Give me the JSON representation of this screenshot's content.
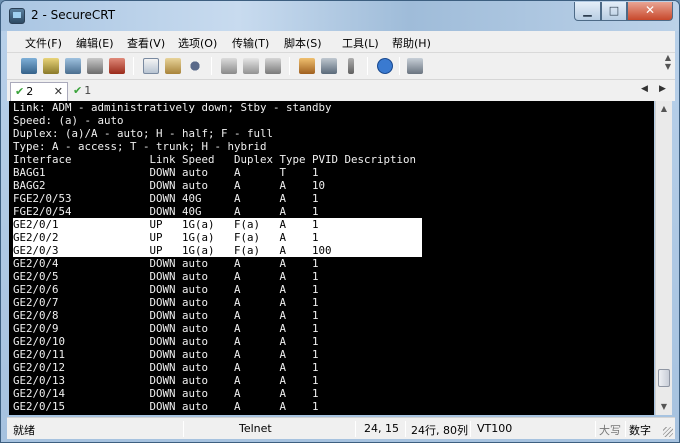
{
  "window": {
    "title": "2 - SecureCRT"
  },
  "menu": [
    "文件(F)",
    "编辑(E)",
    "查看(V)",
    "选项(O)",
    "传输(T)",
    "脚本(S)",
    "工具(L)",
    "帮助(H)"
  ],
  "toolbar": {
    "icons": [
      "connect-icon",
      "quick-connect-icon",
      "connect-in-tab-icon",
      "reconnect-icon",
      "disconnect-icon",
      "copy-icon",
      "paste-icon",
      "find-icon",
      "print-setup-icon",
      "print-icon",
      "print-screen-icon",
      "session-options-icon",
      "global-options-icon",
      "keymap-icon",
      "help-icon",
      "connect-sftp-icon"
    ]
  },
  "tabs": [
    {
      "label": "2",
      "active": true,
      "close": "✕"
    },
    {
      "label": "1",
      "active": false
    }
  ],
  "terminal": {
    "lines": [
      {
        "text": "Link: ADM - administratively down; Stby - standby"
      },
      {
        "text": "Speed: (a) - auto"
      },
      {
        "text": "Duplex: (a)/A - auto; H - half; F - full"
      },
      {
        "text": "Type: A - access; T - trunk; H - hybrid"
      },
      {
        "text": "Interface            Link Speed   Duplex Type PVID Description"
      },
      {
        "text": "BAGG1                DOWN auto    A      T    1"
      },
      {
        "text": "BAGG2                DOWN auto    A      A    10"
      },
      {
        "text": "FGE2/0/53            DOWN 40G     A      A    1"
      },
      {
        "text": "FGE2/0/54            DOWN 40G     A      A    1"
      },
      {
        "text": "GE2/0/1              UP   1G(a)   F(a)   A    1",
        "selected": true
      },
      {
        "text": "GE2/0/2              UP   1G(a)   F(a)   A    1",
        "selected": true
      },
      {
        "text": "GE2/0/3              UP   1G(a)   F(a)   A    100",
        "selected": true
      },
      {
        "text": "GE2/0/4              DOWN auto    A      A    1"
      },
      {
        "text": "GE2/0/5              DOWN auto    A      A    1"
      },
      {
        "text": "GE2/0/6              DOWN auto    A      A    1"
      },
      {
        "text": "GE2/0/7              DOWN auto    A      A    1"
      },
      {
        "text": "GE2/0/8              DOWN auto    A      A    1"
      },
      {
        "text": "GE2/0/9              DOWN auto    A      A    1"
      },
      {
        "text": "GE2/0/10             DOWN auto    A      A    1"
      },
      {
        "text": "GE2/0/11             DOWN auto    A      A    1"
      },
      {
        "text": "GE2/0/12             DOWN auto    A      A    1"
      },
      {
        "text": "GE2/0/13             DOWN auto    A      A    1"
      },
      {
        "text": "GE2/0/14             DOWN auto    A      A    1"
      },
      {
        "text": "GE2/0/15             DOWN auto    A      A    1"
      }
    ]
  },
  "status": {
    "ready": "就绪",
    "protocol": "Telnet",
    "cursor": "24, 15",
    "size": "24行, 80列",
    "emulation": "VT100",
    "caps": "大写",
    "num": "数字"
  }
}
